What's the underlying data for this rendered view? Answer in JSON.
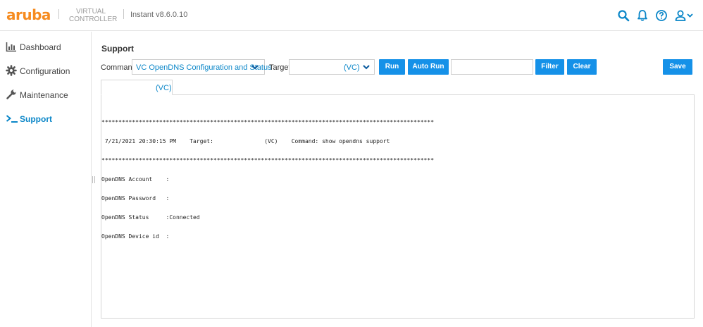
{
  "header": {
    "logo": "aruba",
    "product_line1": "VIRTUAL",
    "product_line2": "CONTROLLER",
    "version": "Instant v8.6.0.10",
    "accent_color": "#f68b1f",
    "icons": [
      "search-icon",
      "bell-icon",
      "help-icon",
      "user-icon"
    ]
  },
  "sidebar": {
    "items": [
      {
        "label": "Dashboard",
        "icon": "chart-icon",
        "active": false
      },
      {
        "label": "Configuration",
        "icon": "gear-icon",
        "active": false
      },
      {
        "label": "Maintenance",
        "icon": "wrench-icon",
        "active": false
      },
      {
        "label": "Support",
        "icon": "terminal-icon",
        "active": true
      }
    ],
    "active_color": "#0a86c8"
  },
  "main": {
    "title": "Support",
    "command_label": "Command:",
    "command_value": "VC OpenDNS Configuration and Status",
    "target_label": "Target:",
    "target_value": "(VC)",
    "run_label": "Run",
    "autorun_label": "Auto Run",
    "filter_value": "",
    "filter_label": "Filter",
    "clear_label": "Clear",
    "save_label": "Save",
    "button_color": "#1591e8",
    "tab_label": "(VC)",
    "output": {
      "rule": "**************************************************************************************************",
      "header": " 7/21/2021 20:30:15 PM    Target:               (VC)    Command: show opendns support",
      "lines": [
        "OpenDNS Account    :",
        "OpenDNS Password   :",
        "OpenDNS Status     :Connected",
        "OpenDNS Device id  :"
      ]
    }
  }
}
